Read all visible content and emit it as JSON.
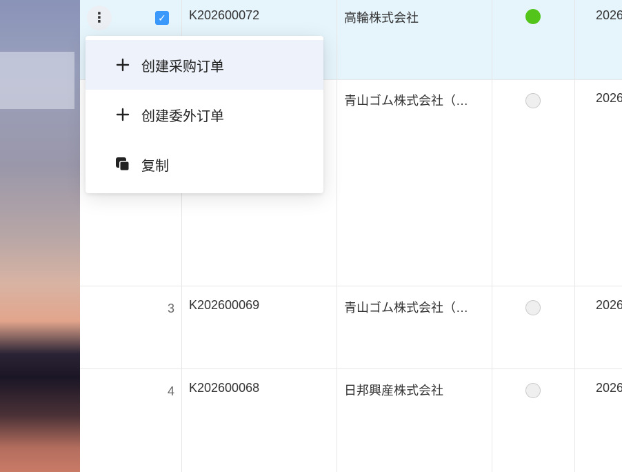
{
  "rows": [
    {
      "index": "",
      "code": "K202600072",
      "customer": "高輪株式会社",
      "status": "on",
      "date": "2026"
    },
    {
      "index": "",
      "code": "",
      "customer": "青山ゴム株式会社（…",
      "status": "off",
      "date": "2026"
    },
    {
      "index": "3",
      "code": "K202600069",
      "customer": "青山ゴム株式会社（…",
      "status": "off",
      "date": "2026"
    },
    {
      "index": "4",
      "code": "K202600068",
      "customer": "日邦興産株式会社",
      "status": "off",
      "date": "2026"
    }
  ],
  "row_actions": {
    "more_icon": "more-vertical-icon",
    "checkbox_checked": true
  },
  "context_menu": {
    "items": [
      {
        "label": "创建采购订单",
        "icon": "plus-icon"
      },
      {
        "label": "创建委外订单",
        "icon": "plus-icon"
      },
      {
        "label": "复制",
        "icon": "copy-icon"
      }
    ]
  },
  "colors": {
    "selected_row": "#e6f4fc",
    "status_on": "#52c41a",
    "checkbox": "#3b99fc",
    "menu_hover": "#eef2fb"
  }
}
